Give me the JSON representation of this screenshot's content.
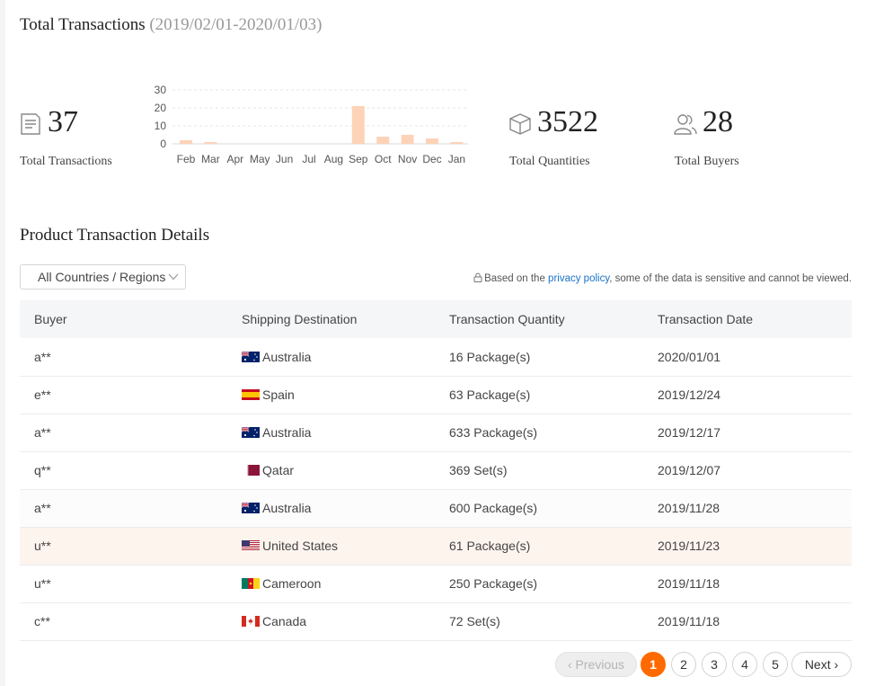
{
  "header": {
    "title": "Total Transactions",
    "date_range": "(2019/02/01-2020/01/03)"
  },
  "stats": {
    "transactions": {
      "value": "37",
      "label": "Total Transactions",
      "icon": "document-icon"
    },
    "quantities": {
      "value": "3522",
      "label": "Total Quantities",
      "icon": "box-icon"
    },
    "buyers": {
      "value": "28",
      "label": "Total Buyers",
      "icon": "users-icon"
    }
  },
  "chart_data": {
    "type": "bar",
    "categories": [
      "Feb",
      "Mar",
      "Apr",
      "May",
      "Jun",
      "Jul",
      "Aug",
      "Sep",
      "Oct",
      "Nov",
      "Dec",
      "Jan"
    ],
    "values": [
      2,
      1,
      0,
      0,
      0,
      0,
      0,
      21,
      4,
      5,
      3,
      1
    ],
    "yticks": [
      "0",
      "10",
      "20",
      "30"
    ],
    "ylim": [
      0,
      30
    ],
    "grid": true,
    "bar_color": "#fdd3b8"
  },
  "details": {
    "title": "Product Transaction Details",
    "filter": "All Countries / Regions",
    "notice_prefix": "Based on the ",
    "notice_link": "privacy policy",
    "notice_suffix": ", some of the data is sensitive and cannot be viewed.",
    "columns": [
      "Buyer",
      "Shipping Destination",
      "Transaction Quantity",
      "Transaction Date"
    ],
    "rows": [
      {
        "buyer": "a**",
        "country": "Australia",
        "flag": "au",
        "quantity": "16 Package(s)",
        "date": "2020/01/01"
      },
      {
        "buyer": "e**",
        "country": "Spain",
        "flag": "es",
        "quantity": "63 Package(s)",
        "date": "2019/12/24"
      },
      {
        "buyer": "a**",
        "country": "Australia",
        "flag": "au",
        "quantity": "633 Package(s)",
        "date": "2019/12/17"
      },
      {
        "buyer": "q**",
        "country": "Qatar",
        "flag": "qa",
        "quantity": "369 Set(s)",
        "date": "2019/12/07"
      },
      {
        "buyer": "a**",
        "country": "Australia",
        "flag": "au",
        "quantity": "600 Package(s)",
        "date": "2019/11/28"
      },
      {
        "buyer": "u**",
        "country": "United States",
        "flag": "us",
        "quantity": "61 Package(s)",
        "date": "2019/11/23"
      },
      {
        "buyer": "u**",
        "country": "Cameroon",
        "flag": "cm",
        "quantity": "250 Package(s)",
        "date": "2019/11/18"
      },
      {
        "buyer": "c**",
        "country": "Canada",
        "flag": "ca",
        "quantity": "72 Set(s)",
        "date": "2019/11/18"
      }
    ]
  },
  "pagination": {
    "previous": "Previous",
    "next": "Next",
    "pages": [
      "1",
      "2",
      "3",
      "4",
      "5"
    ],
    "current": "1",
    "accent": "#ff6a00"
  }
}
